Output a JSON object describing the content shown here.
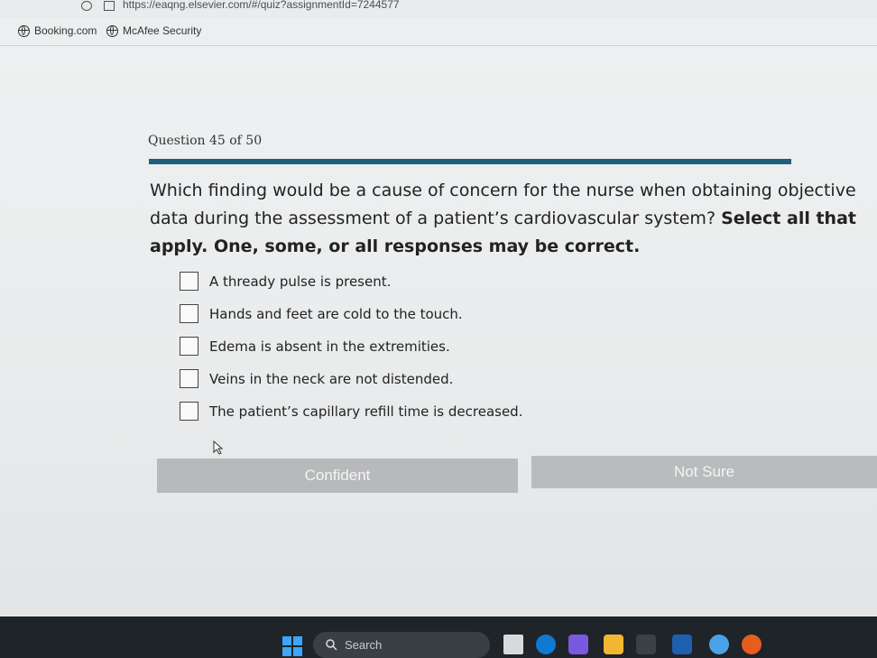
{
  "browser": {
    "url": "https://eaqng.elsevier.com/#/quiz?assignmentId=7244577",
    "bookmarks": [
      "Booking.com",
      "McAfee Security"
    ]
  },
  "quiz": {
    "question_counter": "Question 45 of 50",
    "question_text": "Which finding would be a cause of concern for the nurse when obtaining objective data during the assessment of a patient’s cardiovascular system? ",
    "question_instruction": "Select all that apply. One, some, or all responses may be correct.",
    "options": [
      "A thready pulse is present.",
      "Hands and feet are cold to the touch.",
      "Edema is absent in the extremities.",
      "Veins in the neck are not distended.",
      "The patient’s capillary refill time is decreased."
    ],
    "buttons": {
      "confident": "Confident",
      "not_sure": "Not Sure"
    }
  },
  "taskbar": {
    "search_placeholder": "Search",
    "accent": "#3aa6ff"
  }
}
